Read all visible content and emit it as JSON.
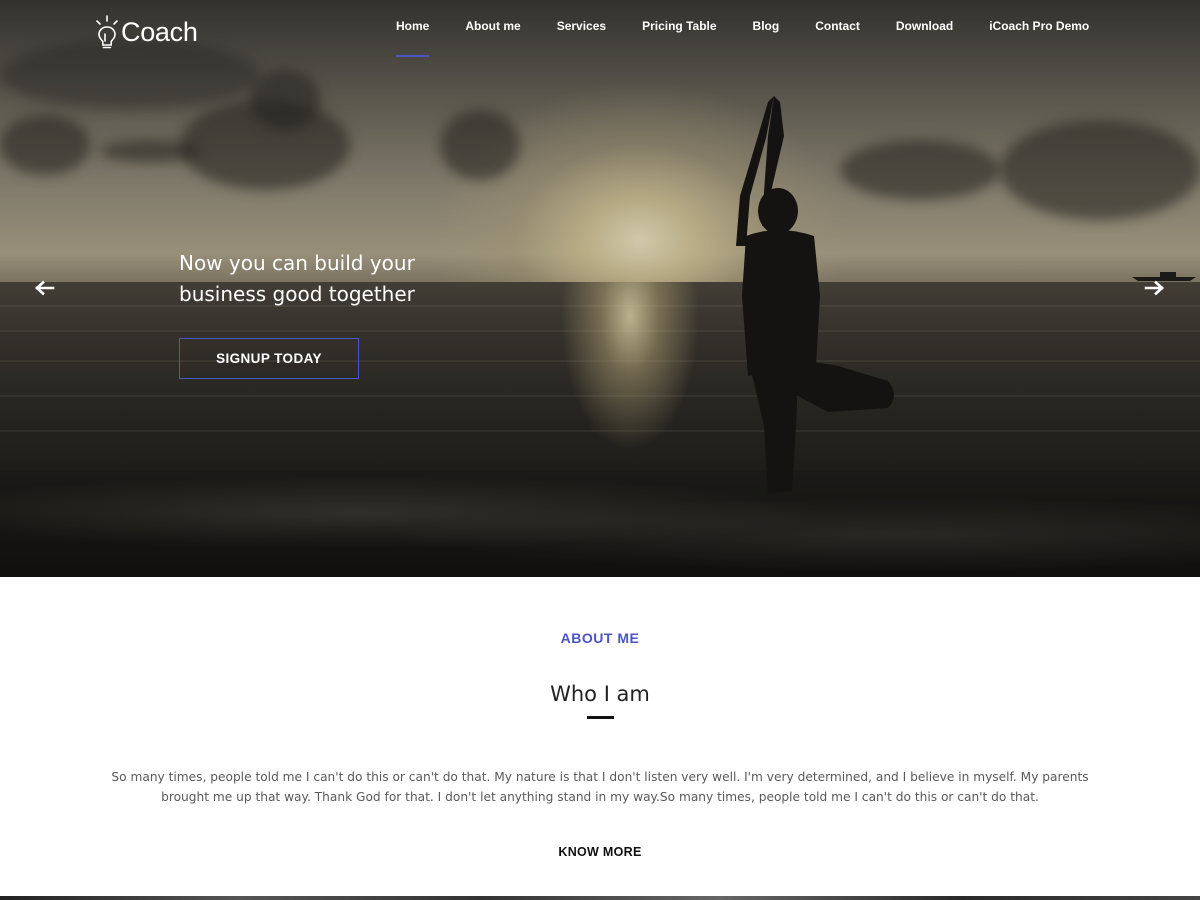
{
  "brand": {
    "name": "Coach",
    "logo_icon": "lightbulb-icon"
  },
  "nav": {
    "items": [
      {
        "label": "Home",
        "active": true
      },
      {
        "label": "About me"
      },
      {
        "label": "Services"
      },
      {
        "label": "Pricing Table"
      },
      {
        "label": "Blog"
      },
      {
        "label": "Contact"
      },
      {
        "label": "Download"
      },
      {
        "label": "iCoach Pro Demo"
      }
    ]
  },
  "hero": {
    "title_line1": "Now you can build your",
    "title_line2": "business good together",
    "cta_label": "SIGNUP TODAY",
    "prev_icon": "arrow-left-icon",
    "next_icon": "arrow-right-icon"
  },
  "about": {
    "label": "ABOUT ME",
    "title": "Who I am",
    "text": "So many times, people told me I can't do this or can't do that. My nature is that I don't listen very well. I'm very determined, and I believe in myself. My parents brought me up that way. Thank God for that. I don't let anything stand in my way.So many times, people told me I can't do this or can't do that.",
    "link_label": "KNOW MORE"
  },
  "colors": {
    "accent": "#4a55c7",
    "text_dark": "#222222",
    "text_body": "#5a5a5a",
    "white": "#ffffff"
  }
}
